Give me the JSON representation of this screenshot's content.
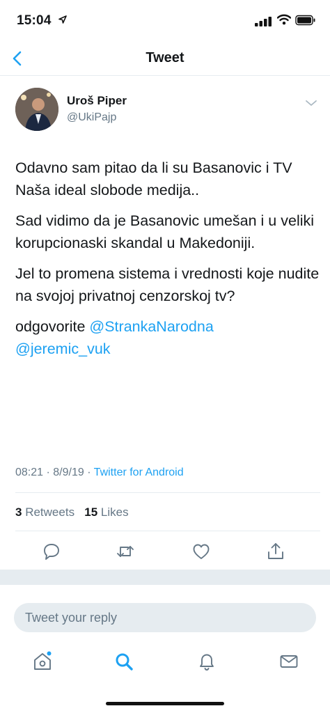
{
  "status_bar": {
    "time": "15:04"
  },
  "nav": {
    "title": "Tweet"
  },
  "author": {
    "name": "Uroš Piper",
    "handle": "@UkiPajp"
  },
  "tweet": {
    "p1": "Odavno sam pitao da li su Basanovic i TV Naša ideal slobode medija..",
    "p2": "Sad vidimo da je Basanovic umešan i u veliki korupcionaski skandal u Makedoniji.",
    "p3": "Jel to promena sistema i vrednosti koje nudite na svojoj privatnoj cenzorskoj tv?",
    "p4_prefix": "odgovorite ",
    "mention1": "@StrankaNarodna",
    "mention2": "@jeremic_vuk"
  },
  "meta": {
    "timestamp": "08:21 · 8/9/19 · ",
    "source": "Twitter for Android"
  },
  "stats": {
    "retweets_count": "3",
    "retweets_label": "Retweets",
    "likes_count": "15",
    "likes_label": "Likes"
  },
  "reply": {
    "placeholder": "Tweet your reply"
  },
  "colors": {
    "accent": "#1da1f2",
    "text": "#14171a",
    "secondary": "#657786",
    "divider": "#e6ecf0"
  },
  "icons": [
    "location-arrow-icon",
    "signal-icon",
    "wifi-icon",
    "battery-icon",
    "back-chevron-icon",
    "caret-down-icon",
    "reply-icon",
    "retweet-icon",
    "like-icon",
    "share-icon",
    "home-icon",
    "search-icon",
    "notifications-icon",
    "messages-icon"
  ]
}
